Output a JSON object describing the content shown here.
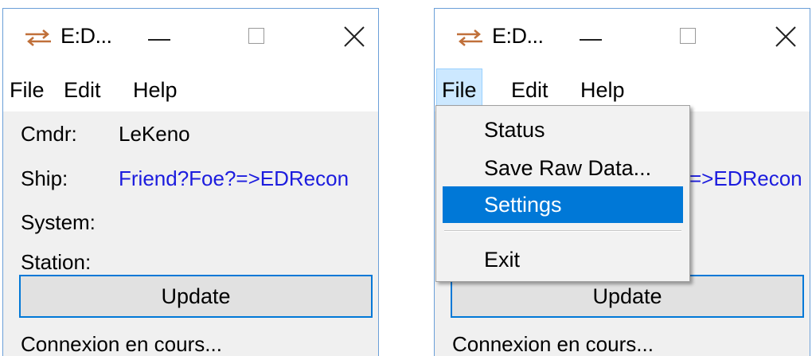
{
  "window": {
    "title": "E:D...",
    "menu": [
      "File",
      "Edit",
      "Help"
    ]
  },
  "fields": {
    "cmdr_label": "Cmdr:",
    "cmdr_value": "LeKeno",
    "ship_label": "Ship:",
    "ship_value": "Friend?Foe?=>EDRecon",
    "ship_value_partial": "=>EDRecon",
    "system_label": "System:",
    "station_label": "Station:"
  },
  "update_button": "Update",
  "status": "Connexion en cours...",
  "file_menu": {
    "items": [
      "Status",
      "Save Raw Data...",
      "Settings",
      "Exit"
    ],
    "highlighted": "Settings"
  },
  "colors": {
    "link": "#1c1cde",
    "accent": "#0078d7",
    "menu_active_bg": "#cce8ff"
  },
  "icons": {
    "app": "arrows-swap-icon",
    "minimize": "minimize-icon",
    "maximize": "maximize-icon",
    "close": "close-icon"
  }
}
